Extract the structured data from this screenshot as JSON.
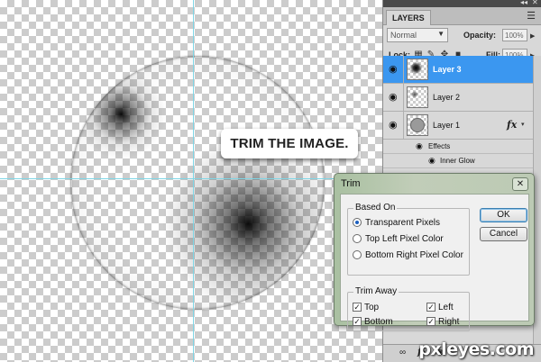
{
  "canvas": {
    "callout_text": "TRIM THE IMAGE."
  },
  "layers_panel": {
    "tab_label": "LAYERS",
    "menu_icon": "panel-menu-icon",
    "blend_mode": "Normal",
    "opacity_label": "Opacity:",
    "opacity_value": "100%",
    "lock_label": "Lock:",
    "fill_label": "Fill:",
    "fill_value": "100%",
    "layers": [
      {
        "name": "Layer 3",
        "selected": true
      },
      {
        "name": "Layer 2",
        "selected": false
      },
      {
        "name": "Layer 1",
        "selected": false,
        "fx": "fx"
      }
    ],
    "effects_label": "Effects",
    "inner_glow_label": "Inner Glow",
    "bottom_fx": "fx."
  },
  "trim_dialog": {
    "title": "Trim",
    "close_glyph": "✕",
    "based_on_legend": "Based On",
    "based_on_options": [
      {
        "label": "Transparent Pixels",
        "selected": true
      },
      {
        "label": "Top Left Pixel Color",
        "selected": false
      },
      {
        "label": "Bottom Right Pixel Color",
        "selected": false
      }
    ],
    "trim_away_legend": "Trim Away",
    "trim_away": {
      "top": "Top",
      "bottom": "Bottom",
      "left": "Left",
      "right": "Right"
    },
    "ok_label": "OK",
    "cancel_label": "Cancel"
  },
  "watermark": "pxleyes.com",
  "colors": {
    "selected_layer": "#3b97f0",
    "guide": "#7fd6e6",
    "dialog_frame": "#bccab4"
  }
}
